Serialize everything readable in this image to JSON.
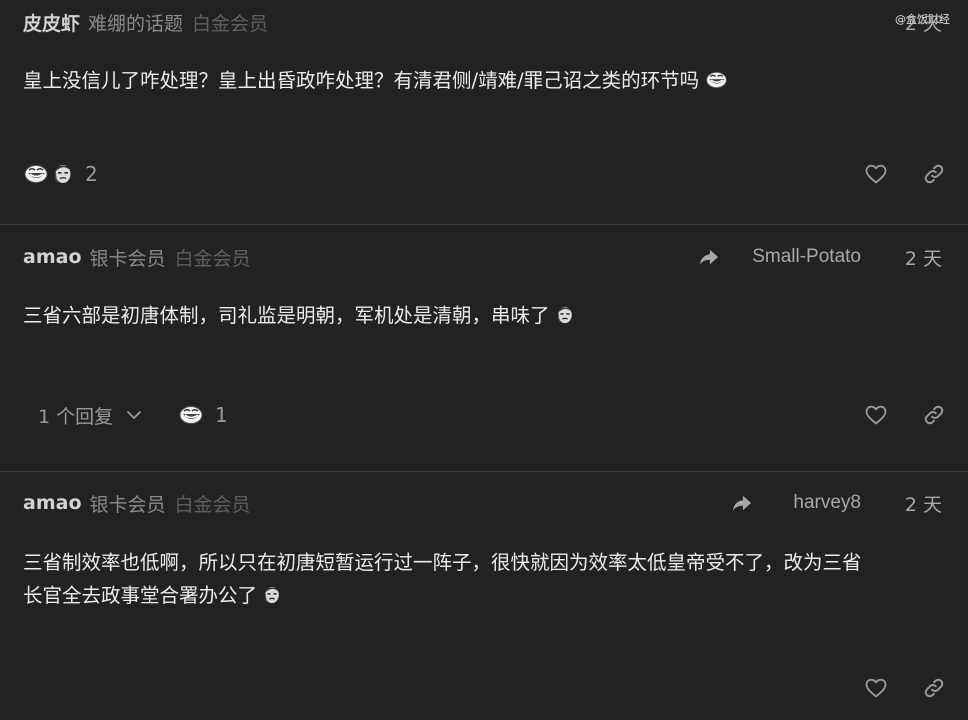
{
  "watermark": "@盒饭财经",
  "posts": [
    {
      "username": "皮皮虾",
      "user_title": "难绷的话题",
      "user_badge": "白金会员",
      "date": "2 天",
      "body_line1": "皇上没信儿了咋处理？皇上出昏政咋处理？有清君侧/靖难/罪己诏之类的环节吗",
      "reaction_count": "2"
    },
    {
      "username": "amao",
      "user_title": "银卡会员",
      "user_badge": "白金会员",
      "reply_to": "Small-Potato",
      "date": "2 天",
      "body_line1": "三省六部是初唐体制，司礼监是明朝，军机处是清朝，串味了",
      "replies_label": "1 个回复",
      "reaction_count": "1"
    },
    {
      "username": "amao",
      "user_title": "银卡会员",
      "user_badge": "白金会员",
      "reply_to": "harvey8",
      "date": "2 天",
      "body_line1": "三省制效率也低啊，所以只在初唐短暂运行过一阵子，很快就因为效率太低皇帝受不了，改为三省",
      "body_line2": "长官全去政事堂合署办公了"
    }
  ],
  "icons": {
    "heart": "heart-icon",
    "link": "link-icon",
    "reply_arrow": "reply-arrow-icon",
    "chevron": "chevron-down-icon",
    "emoji_laugh": "laughing-face-emoji",
    "emoji_man": "smirk-face-emoji"
  },
  "colors": {
    "background": "#222222",
    "divider": "#3a3a3a",
    "text": "#ececec",
    "muted": "#8a8a8a"
  }
}
